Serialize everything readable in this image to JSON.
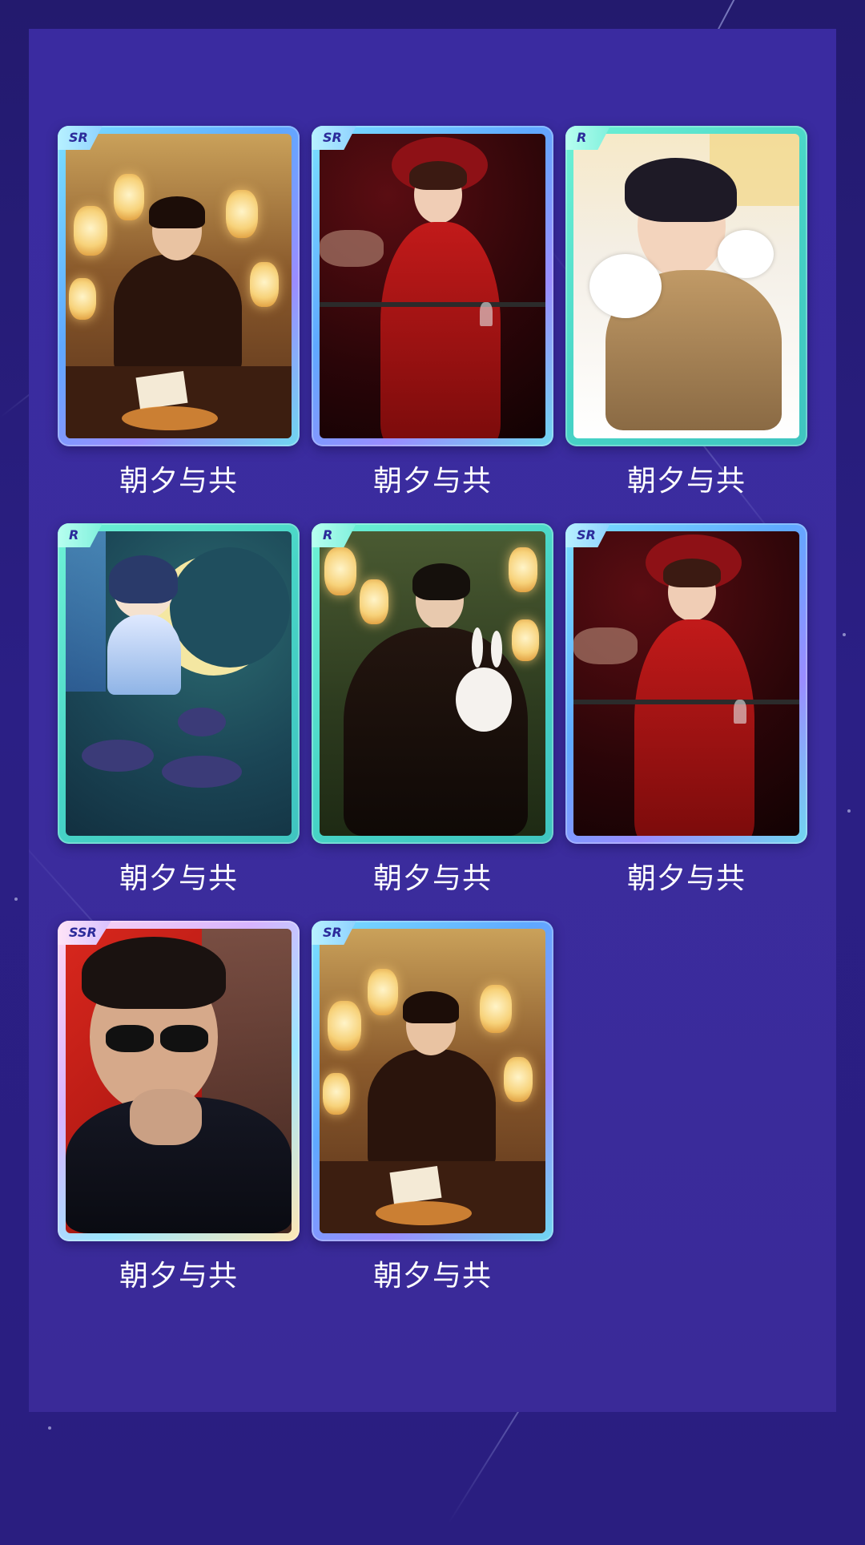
{
  "colors": {
    "background": "#2b1f85",
    "panel": "#3b2c9e",
    "sr_frame": "#5fa8ff",
    "r_frame": "#47d4c6",
    "ssr_frame": "#d7b4ff",
    "title_text": "#ffffff"
  },
  "cards": [
    {
      "rarity": "SR",
      "title": "朝夕与共",
      "art": "lantern-calligraphy-scene"
    },
    {
      "rarity": "SR",
      "title": "朝夕与共",
      "art": "red-suit-hat-portrait"
    },
    {
      "rarity": "R",
      "title": "朝夕与共",
      "art": "smiling-man-with-cats"
    },
    {
      "rarity": "R",
      "title": "朝夕与共",
      "art": "chibi-moon-scene"
    },
    {
      "rarity": "R",
      "title": "朝夕与共",
      "art": "black-robe-rabbit-mask"
    },
    {
      "rarity": "SR",
      "title": "朝夕与共",
      "art": "red-suit-hat-portrait"
    },
    {
      "rarity": "SSR",
      "title": "朝夕与共",
      "art": "sunglasses-portrait"
    },
    {
      "rarity": "SR",
      "title": "朝夕与共",
      "art": "lantern-calligraphy-scene"
    }
  ]
}
